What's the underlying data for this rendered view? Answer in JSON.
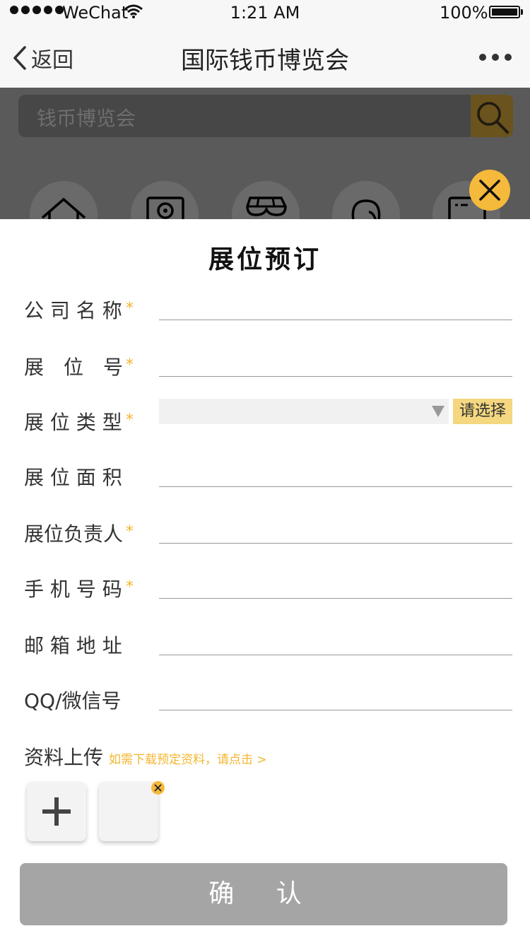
{
  "status_bar": {
    "carrier": "WeChat",
    "time": "1:21 AM",
    "battery": "100%"
  },
  "nav": {
    "back_label": "返回",
    "title": "国际钱币博览会"
  },
  "search": {
    "placeholder": "钱币博览会"
  },
  "icons": {
    "home": "home-icon",
    "location": "map-pin-icon",
    "shop": "store-icon",
    "service": "headset-icon",
    "news": "news-icon"
  },
  "sheet": {
    "title": "展位预订",
    "fields": [
      {
        "label": "公 司 名 称",
        "required": true
      },
      {
        "label": "展　位　号",
        "required": true
      },
      {
        "label": "展 位 类 型",
        "required": true
      },
      {
        "label": "展 位 面 积",
        "required": false
      },
      {
        "label": "展位负责人",
        "required": true
      },
      {
        "label": "手 机 号 码",
        "required": true
      },
      {
        "label": "邮 箱 地 址",
        "required": false
      },
      {
        "label": "QQ/微信号",
        "required": false
      }
    ],
    "required_mark": "*",
    "select_button": "请选择",
    "upload_label": "资料上传",
    "upload_hint": "如需下载预定资料，请点击 >",
    "confirm": "确 认"
  },
  "colors": {
    "accent": "#f5b93b",
    "confirm_bg": "#a5a5a5",
    "select_btn": "#f4d77f"
  }
}
